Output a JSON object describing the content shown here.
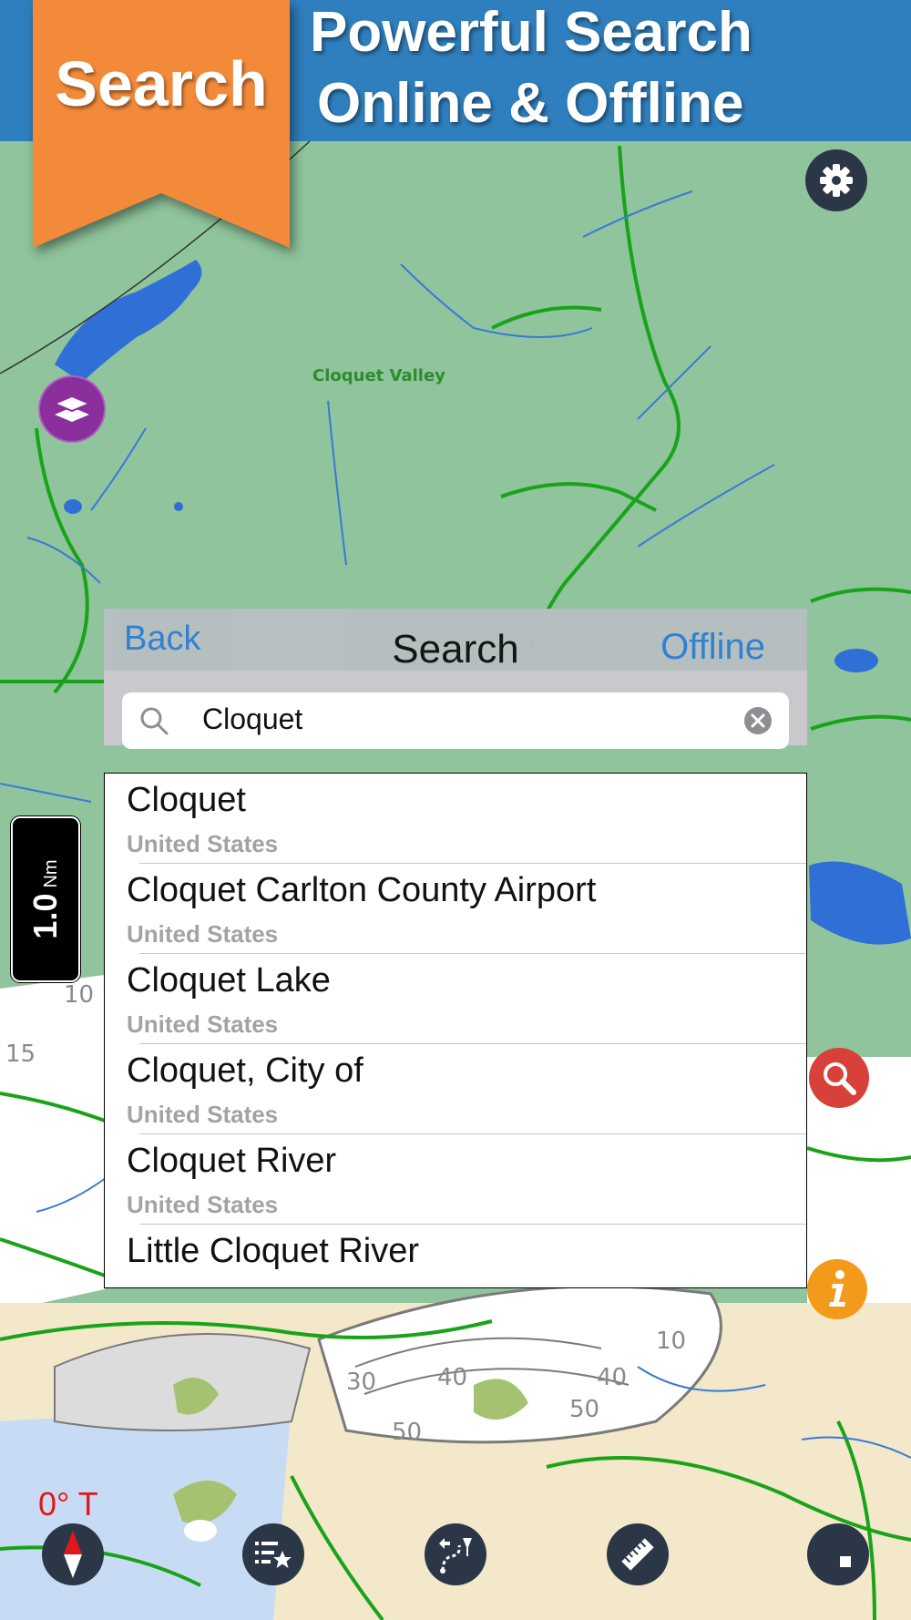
{
  "banner": {
    "ribbon_label": "Search",
    "headline_line1": "Powerful Search",
    "headline_line2": "Online & Offline"
  },
  "map": {
    "place_label": "Cloquet Valley",
    "depth_labels": [
      "10",
      "15",
      "30",
      "40",
      "50",
      "40",
      "50",
      "10"
    ],
    "scale_value": "1.0",
    "scale_unit": "Nm",
    "heading": "0° T"
  },
  "search_panel": {
    "back_label": "Back",
    "title": "Search",
    "offline_label": "Offline",
    "query": "Cloquet",
    "results": [
      {
        "name": "Cloquet",
        "country": "United States"
      },
      {
        "name": "Cloquet Carlton County Airport",
        "country": "United States"
      },
      {
        "name": "Cloquet Lake",
        "country": "United States"
      },
      {
        "name": "Cloquet, City of",
        "country": "United States"
      },
      {
        "name": "Cloquet River",
        "country": "United States"
      },
      {
        "name": "Little Cloquet River",
        "country": ""
      }
    ]
  },
  "icons": {
    "settings": "gear-icon",
    "layers": "layers-icon",
    "search": "magnifier-icon",
    "info": "info-icon",
    "compass": "compass-icon",
    "favorites": "favorites-list-icon",
    "route": "route-icon",
    "ruler": "ruler-icon",
    "track": "stop-icon",
    "clear": "clear-icon"
  },
  "colors": {
    "banner_blue": "#2f7fbe",
    "ribbon_orange": "#f28a3a",
    "land_green": "#8fc49c",
    "water_blue": "#2f6fd6",
    "accent_link": "#2f7fd3",
    "heading_red": "#e0181b"
  }
}
